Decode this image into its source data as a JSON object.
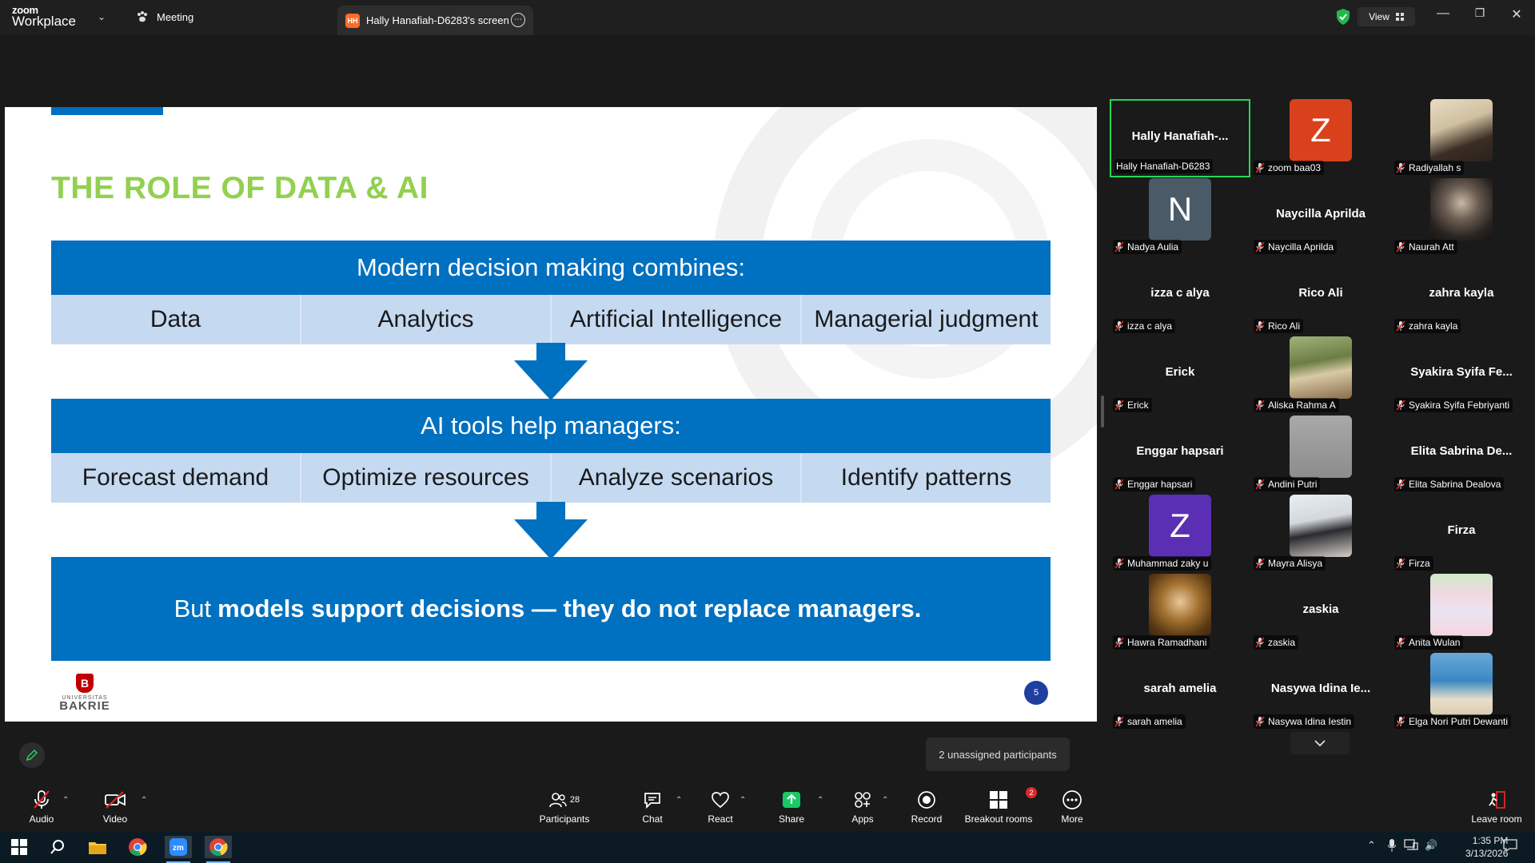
{
  "titlebar": {
    "logo_line1": "zoom",
    "logo_line2": "Workplace",
    "meeting_label": "Meeting",
    "tab_badge": "HH",
    "tab_title": "Hally Hanafiah-D6283's screen",
    "view_label": "View"
  },
  "slide": {
    "title": "THE ROLE OF DATA & AI",
    "header1": "Modern decision making combines:",
    "row1": [
      "Data",
      "Analytics",
      "Artificial Intelligence",
      "Managerial judgment"
    ],
    "header2": "AI tools help managers:",
    "row2": [
      "Forecast demand",
      "Optimize resources",
      "Analyze scenarios",
      "Identify patterns"
    ],
    "bottom_pre": "But",
    "bottom_bold": "models support decisions — they do not replace managers.",
    "logo_line1": "UNIVERSITAS",
    "logo_line2": "BAKRIE",
    "logo_mark": "B",
    "page_number": "5",
    "colors": {
      "title": "#92d050",
      "blue": "#0070c0",
      "cell": "#c5d9f1"
    }
  },
  "participants": [
    {
      "display": "Hally  Hanafiah-...",
      "tag": "Hally Hanafiah-D6283",
      "type": "name",
      "active": true,
      "muted": false
    },
    {
      "display": "Z",
      "tag": "zoom baa03",
      "type": "avatar",
      "color": "#d9411c",
      "muted": true
    },
    {
      "display": "",
      "tag": "Radiyallah s",
      "type": "photo",
      "photo": "linear-gradient(160deg,#e8dcc3 0%,#cfc0a0 40%,#3a2d25 70%,#2a211c 100%)",
      "muted": true
    },
    {
      "display": "N",
      "tag": "Nadya Aulia",
      "type": "avatar",
      "color": "#4a5a66",
      "muted": true
    },
    {
      "display": "Naycilla Aprilda",
      "tag": "Naycilla Aprilda",
      "type": "name",
      "muted": true
    },
    {
      "display": "",
      "tag": "Naurah Att",
      "type": "photo",
      "photo": "radial-gradient(circle at 50% 40%,#c7b8a6 0%,#6b5d52 35%,#2a2522 70%,#151312 100%)",
      "muted": true
    },
    {
      "display": "izza c alya",
      "tag": "izza c alya",
      "type": "name",
      "muted": true
    },
    {
      "display": "Rico Ali",
      "tag": "Rico Ali",
      "type": "name",
      "muted": true
    },
    {
      "display": "zahra kayla",
      "tag": "zahra kayla",
      "type": "name",
      "muted": true
    },
    {
      "display": "Erick",
      "tag": "Erick",
      "type": "name",
      "muted": true
    },
    {
      "display": "",
      "tag": "Aliska Rahma A",
      "type": "photo",
      "photo": "linear-gradient(170deg,#9fb37a 0%,#6c7d44 40%,#d8c9a6 60%,#8a6c4a 100%)",
      "muted": true
    },
    {
      "display": "Syakira Syifa Fe...",
      "tag": "Syakira Syifa Febriyanti",
      "type": "name",
      "muted": true
    },
    {
      "display": "Enggar hapsari",
      "tag": "Enggar hapsari",
      "type": "name",
      "muted": true
    },
    {
      "display": "",
      "tag": "Andini Putri",
      "type": "photo",
      "photo": "linear-gradient(180deg,#a9a9a9 0%,#9a9a9a 50%,#8c8c8c 100%)",
      "muted": true
    },
    {
      "display": "Elita Sabrina De...",
      "tag": "Elita Sabrina Dealova",
      "type": "name",
      "muted": true
    },
    {
      "display": "Z",
      "tag": "Muhammad zaky u",
      "type": "avatar",
      "color": "#5b2fb3",
      "muted": true
    },
    {
      "display": "",
      "tag": "Mayra Alisya",
      "type": "photo",
      "photo": "linear-gradient(170deg,#e9eef2 0%,#d3d8dc 40%,#2a2a2e 60%,#d5cfc8 100%)",
      "muted": true
    },
    {
      "display": "Firza",
      "tag": "Firza",
      "type": "name",
      "muted": true
    },
    {
      "display": "",
      "tag": "Hawra Ramadhani",
      "type": "photo",
      "photo": "radial-gradient(circle at 50% 45%,#e8c89a 0%,#a47232 40%,#5b3a14 75%,#3a2410 100%)",
      "muted": true
    },
    {
      "display": "zaskia",
      "tag": "zaskia",
      "type": "name",
      "muted": true
    },
    {
      "display": "",
      "tag": "Anita Wulan",
      "type": "photo",
      "photo": "linear-gradient(180deg,#cfe9c9 0%,#f2d8e2 35%,#e9e4f3 60%,#f5d6e0 100%)",
      "muted": true
    },
    {
      "display": "sarah amelia",
      "tag": "sarah amelia",
      "type": "name",
      "muted": true
    },
    {
      "display": "Nasywa Idina Ie...",
      "tag": "Nasywa Idina Iestin",
      "type": "name",
      "muted": true
    },
    {
      "display": "",
      "tag": "Elga Nori Putri Dewanti",
      "type": "photo",
      "photo": "linear-gradient(180deg,#6aa9d8 0%,#3b88c4 45%,#e9dfc9 75%,#d8cdb3 100%)",
      "muted": true
    }
  ],
  "unassigned": "2 unassigned participants",
  "toolbar": {
    "audio": "Audio",
    "video": "Video",
    "participants": "Participants",
    "participants_count": "28",
    "chat": "Chat",
    "react": "React",
    "share": "Share",
    "apps": "Apps",
    "record": "Record",
    "breakout": "Breakout rooms",
    "breakout_badge": "2",
    "more": "More",
    "leave": "Leave room"
  },
  "taskbar": {
    "time": "1:35 PM",
    "date": "3/13/2026"
  }
}
